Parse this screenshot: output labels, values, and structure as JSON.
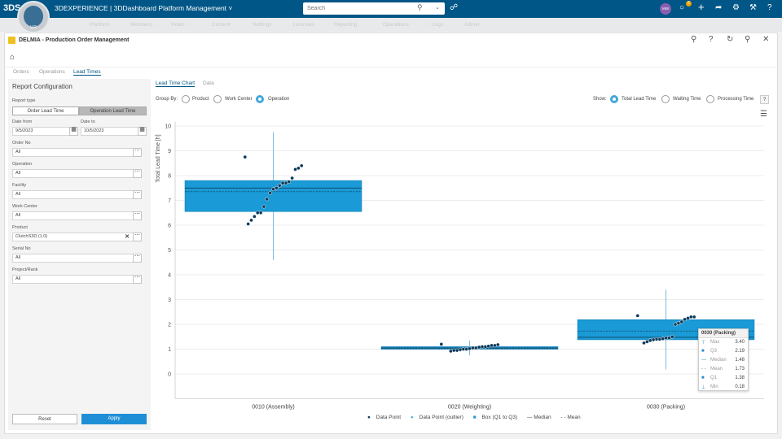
{
  "topbar": {
    "logo": "3DS",
    "brand": "3DEXPERIENCE | 3DDashboard",
    "dashboard": "Platform Management ˅",
    "search_placeholder": "Search",
    "compass_label": "V,R",
    "avatar_initials": "MW",
    "notif_count": "2",
    "accent": "#005686"
  },
  "app": {
    "title": "DELMIA - Production Order Management",
    "tabs": [
      "Orders",
      "Operations",
      "Lead Times"
    ],
    "active_tab": 2
  },
  "report": {
    "title": "Report Configuration",
    "report_type_label": "Report type",
    "report_types": [
      "Order Lead Time",
      "Operation Lead Time"
    ],
    "selected_type": 1,
    "date_from_label": "Date from",
    "date_from": "9/5/2023",
    "date_to_label": "Date to",
    "date_to": "10/5/2023",
    "fields": [
      {
        "label": "Order No",
        "value": "All"
      },
      {
        "label": "Operation",
        "value": "All"
      },
      {
        "label": "Facility",
        "value": "All"
      },
      {
        "label": "Work Center",
        "value": "All"
      },
      {
        "label": "Product",
        "value": "ClutchS3D (1.0)"
      },
      {
        "label": "Serial No",
        "value": "All"
      },
      {
        "label": "Project/Rank",
        "value": "All"
      }
    ],
    "reset_label": "Reset",
    "apply_label": "Apply"
  },
  "chart_view": {
    "tabs": [
      "Lead Time Chart",
      "Data"
    ],
    "group_by_label": "Group By:",
    "group_by_options": [
      "Product",
      "Work Center",
      "Operation"
    ],
    "group_by_selected": 2,
    "show_label": "Show:",
    "show_options": [
      "Total Lead Time",
      "Waiting Time",
      "Processing Time"
    ],
    "show_selected": 0
  },
  "chart_data": {
    "type": "box",
    "ylabel": "Total Lead Time [h]",
    "ylim": [
      -1,
      10
    ],
    "yticks": [
      0,
      1,
      2,
      3,
      4,
      5,
      6,
      7,
      8,
      9,
      10
    ],
    "grid": true,
    "categories": [
      "0010 (Assembly)",
      "0020 (Weighting)",
      "0030 (Packing)"
    ],
    "boxes": [
      {
        "max": 9.75,
        "q3": 7.8,
        "median": 7.5,
        "mean": 7.35,
        "q1": 6.55,
        "min": 4.6
      },
      {
        "max": 1.35,
        "q3": 1.1,
        "median": 1.05,
        "mean": 1.02,
        "q1": 1.0,
        "min": 0.75
      },
      {
        "max": 3.4,
        "q3": 2.19,
        "median": 1.48,
        "mean": 1.73,
        "q1": 1.38,
        "min": 0.18
      }
    ],
    "points": [
      [
        8.75,
        8.4,
        8.3,
        8.25,
        7.9,
        7.75,
        7.7,
        7.7,
        7.6,
        7.5,
        7.45,
        7.3,
        7.05,
        6.75,
        6.5,
        6.5,
        6.35,
        6.2,
        6.05
      ],
      [
        1.2,
        1.18,
        1.15,
        1.15,
        1.12,
        1.1,
        1.1,
        1.08,
        1.05,
        1.05,
        1.02,
        1.0,
        1.0,
        0.98,
        0.95,
        0.95,
        0.92
      ],
      [
        2.35,
        2.3,
        2.3,
        2.25,
        2.2,
        2.1,
        2.05,
        2.0,
        1.5,
        1.45,
        1.45,
        1.42,
        1.4,
        1.4,
        1.38,
        1.35,
        1.3,
        1.25
      ]
    ],
    "legend": [
      "Data Point",
      "Data Point (outlier)",
      "Box (Q1 to Q3)",
      "Median",
      "Mean"
    ],
    "legend_placement": "bottom-center",
    "colors": {
      "box": "#1a9ad6",
      "point": "#0b3c5d"
    }
  },
  "tooltip": {
    "title": "0030 (Packing)",
    "rows": [
      {
        "name": "Max",
        "value": "3.40"
      },
      {
        "name": "Q3",
        "value": "2.19"
      },
      {
        "name": "Median",
        "value": "1.48"
      },
      {
        "name": "Mean",
        "value": "1.73"
      },
      {
        "name": "Q1",
        "value": "1.38"
      },
      {
        "name": "Min",
        "value": "0.18"
      }
    ]
  }
}
